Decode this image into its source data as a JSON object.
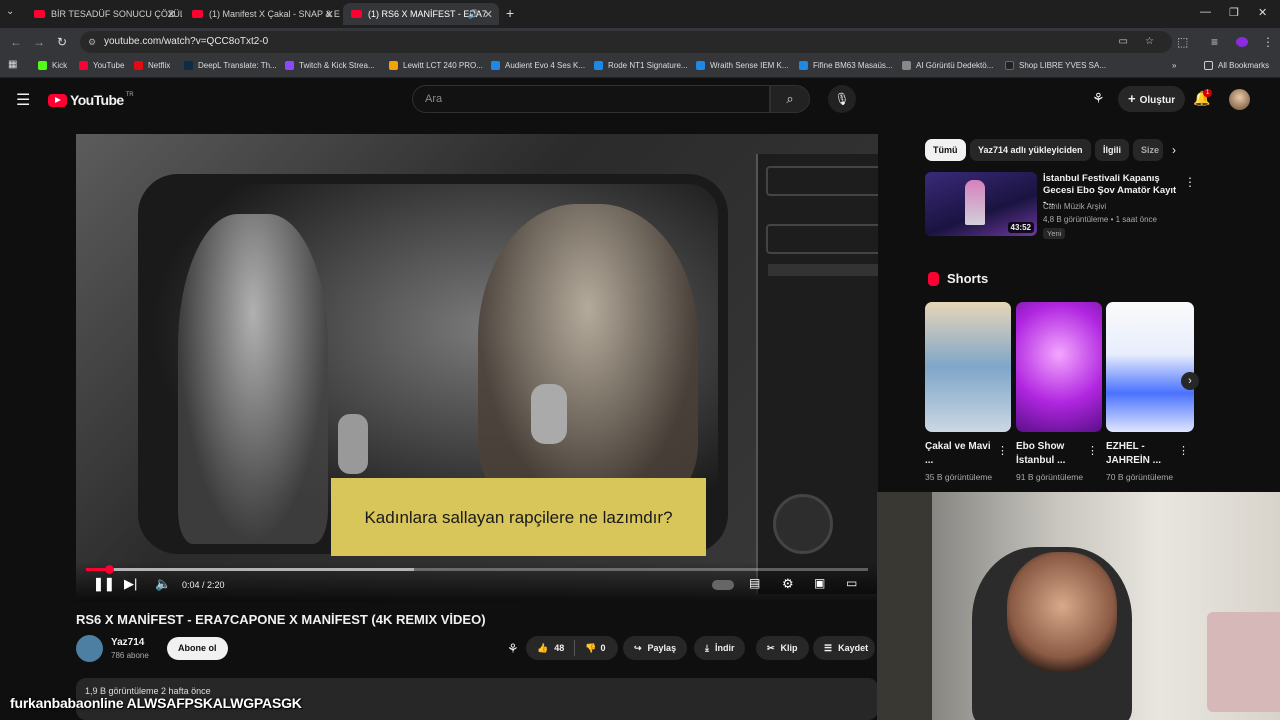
{
  "browser": {
    "tabs": [
      {
        "label": "BİR TESADÜF SONUCU ÇÖZÜLE"
      },
      {
        "label": "(1) Manifest X Çakal - SNAP & E"
      },
      {
        "label": "(1) RS6 X MANİFEST - ERA7"
      }
    ],
    "url": "youtube.com/watch?v=QCC8oTxt2-0",
    "bookmarks": [
      {
        "label": "Kick",
        "color": "#53fc18"
      },
      {
        "label": "YouTube",
        "color": "#ff0033"
      },
      {
        "label": "Netflix",
        "color": "#e50914"
      },
      {
        "label": "DeepL Translate: Th...",
        "color": "#0f2b46"
      },
      {
        "label": "Twitch & Kick Strea...",
        "color": "#9146ff"
      },
      {
        "label": "Lewitt LCT 240 PRO...",
        "color": "#f4a300"
      },
      {
        "label": "Audient Evo 4 Ses K...",
        "color": "#1e88e5"
      },
      {
        "label": "Rode NT1 Signature...",
        "color": "#1e88e5"
      },
      {
        "label": "Wraith Sense IEM K...",
        "color": "#1e88e5"
      },
      {
        "label": "Fifine BM63 Masaüs...",
        "color": "#1e88e5"
      },
      {
        "label": "AI Görüntü Dedektö...",
        "color": "#888888"
      },
      {
        "label": "Shop LIBRE YVES SA...",
        "color": "#222222"
      }
    ],
    "all_bookmarks": "All Bookmarks"
  },
  "youtube": {
    "logo": "YouTube",
    "logo_region": "TR",
    "search_placeholder": "Ara",
    "create_label": "Oluştur",
    "notif_count": "1"
  },
  "video": {
    "subtitle": "Kadınlara sallayan rapçilere ne lazımdır?",
    "time": "0:04 / 2:20",
    "progress": 0.03,
    "buffered": 0.42,
    "title": "RS6 X MANİFEST - ERA7CAPONE X MANİFEST (4K REMIX VİDEO)",
    "channel": "Yaz714",
    "subscribers": "786 abone",
    "subscribe_label": "Abone ol",
    "likes": "48",
    "dislikes": "0",
    "share_label": "Paylaş",
    "download_label": "İndir",
    "clip_label": "Klip",
    "save_label": "Kaydet",
    "description_stats": "1,9 B görüntüleme  2 hafta önce"
  },
  "sidebar": {
    "chips": [
      "Tümü",
      "Yaz714 adlı yükleyiciden",
      "İlgili",
      "Size"
    ],
    "suggestion": {
      "title": "İstanbul Festivali Kapanış Gecesi Ebo Şov Amatör Kayıt -...",
      "channel": "Canlı Müzik Arşivi",
      "meta": "4,8 B görüntüleme • 1 saat önce",
      "badge": "Yeni",
      "duration": "43:52"
    },
    "shorts_title": "Shorts",
    "shorts": [
      {
        "title": "Çakal ve Mavi ...",
        "views": "35 B görüntüleme"
      },
      {
        "title": "Ebo Show İstanbul ...",
        "views": "91 B görüntüleme"
      },
      {
        "title": "EZHEL - JAHREİN ...",
        "views": "70 B görüntüleme"
      }
    ]
  },
  "stream_overlay": "furkanbabaonline ALWSAFPSKALWGPASGK"
}
